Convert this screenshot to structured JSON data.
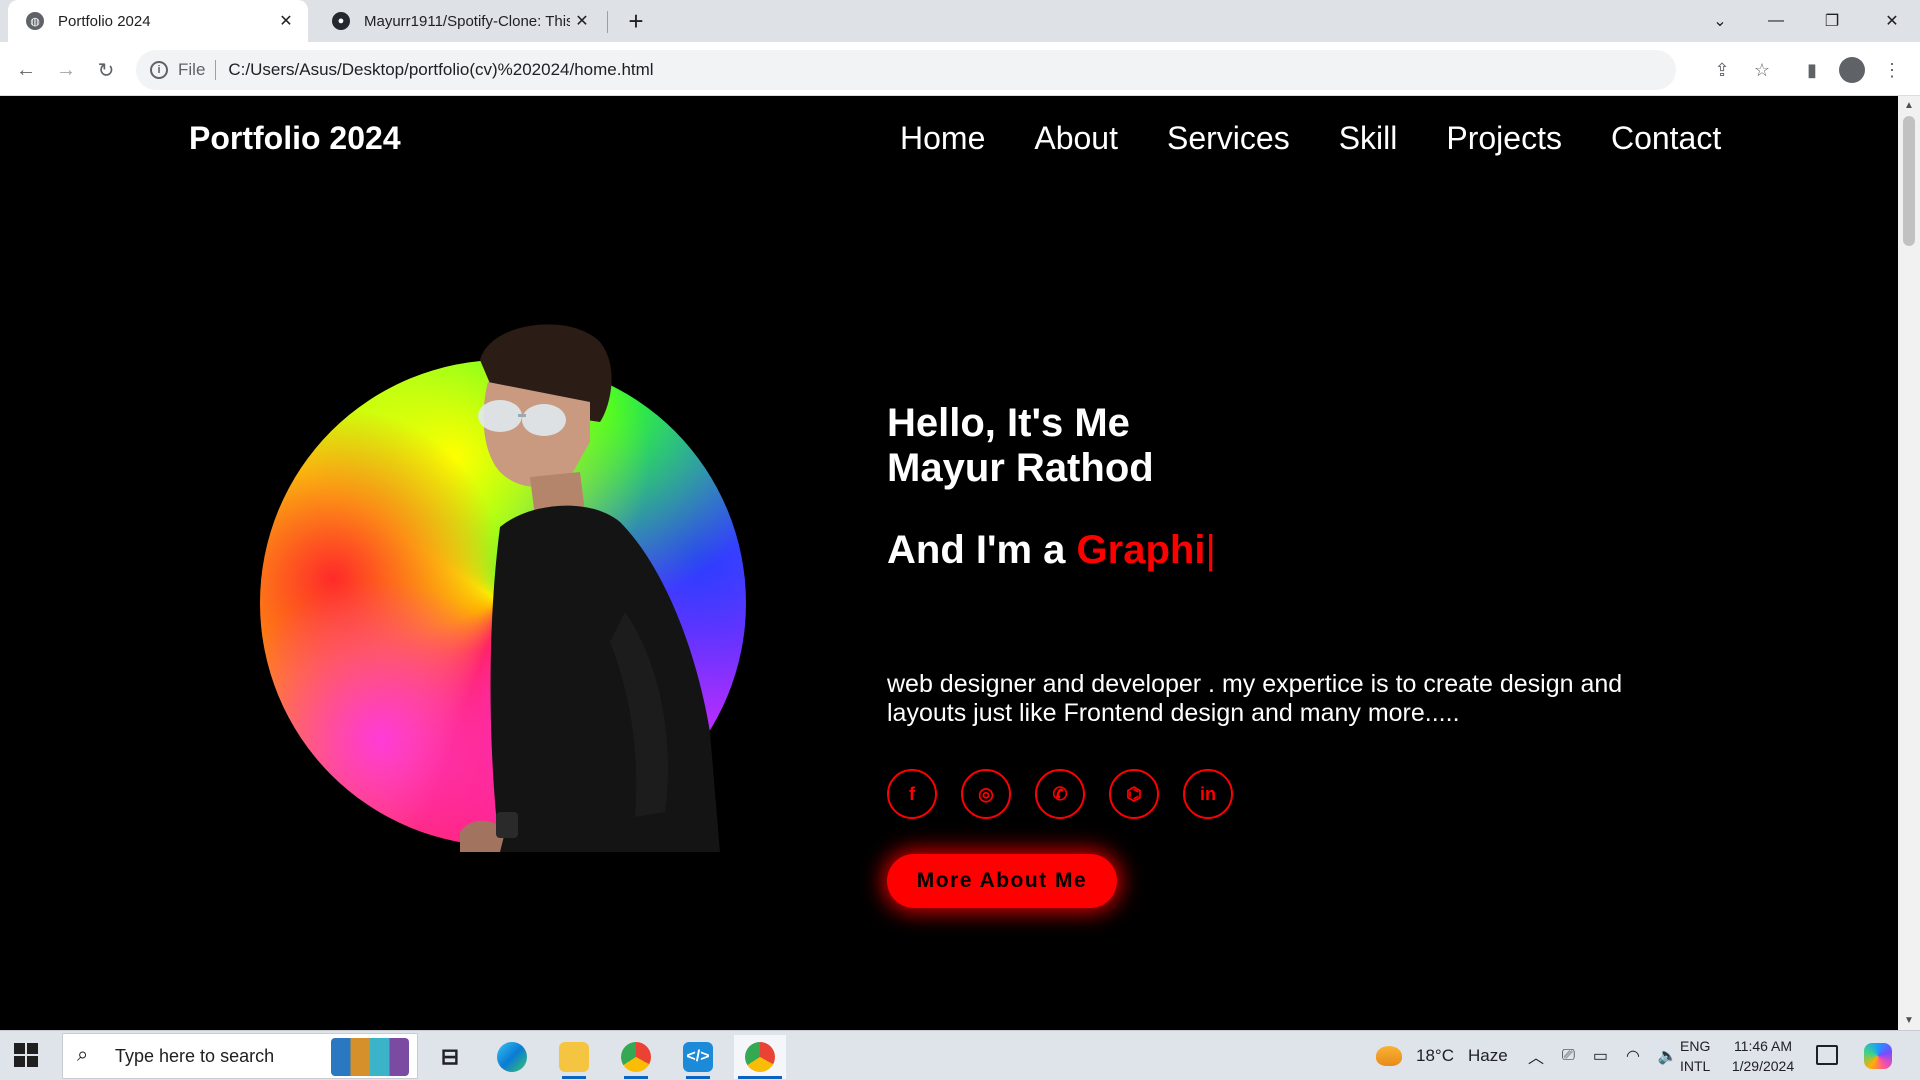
{
  "browser": {
    "tabs": [
      {
        "title": "Portfolio 2024",
        "active": true
      },
      {
        "title": "Mayurr1911/Spotify-Clone: This",
        "active": false
      }
    ],
    "address": {
      "scheme": "File",
      "url": "C:/Users/Asus/Desktop/portfolio(cv)%202024/home.html"
    }
  },
  "site": {
    "logo": "Portfolio 2024",
    "nav": [
      "Home",
      "About",
      "Services",
      "Skill",
      "Projects",
      "Contact"
    ],
    "hero": {
      "greeting": "Hello, It's Me",
      "name": "Mayur Rathod",
      "role_prefix": "And I'm a ",
      "role_typed": "Graphi",
      "caret": "|",
      "description": "web designer and developer . my expertice is to create design and layouts just like Frontend design and many more.....",
      "socials": [
        {
          "name": "facebook",
          "icon": "facebook-icon",
          "glyph": "f"
        },
        {
          "name": "instagram",
          "icon": "instagram-icon",
          "glyph": "◎"
        },
        {
          "name": "whatsapp",
          "icon": "whatsapp-icon",
          "glyph": "✆"
        },
        {
          "name": "github",
          "icon": "github-icon",
          "glyph": "⌬"
        },
        {
          "name": "linkedin",
          "icon": "linkedin-icon",
          "glyph": "in"
        }
      ],
      "cta": "More About Me"
    },
    "back_to_top": "↑",
    "colors": {
      "accent": "#ff0000",
      "background": "#000000",
      "text": "#ffffff"
    }
  },
  "taskbar": {
    "search_placeholder": "Type here to search",
    "weather": {
      "temp": "18°C",
      "condition": "Haze"
    },
    "lang": {
      "line1": "ENG",
      "line2": "INTL"
    },
    "clock": {
      "time": "11:46 AM",
      "date": "1/29/2024"
    }
  }
}
